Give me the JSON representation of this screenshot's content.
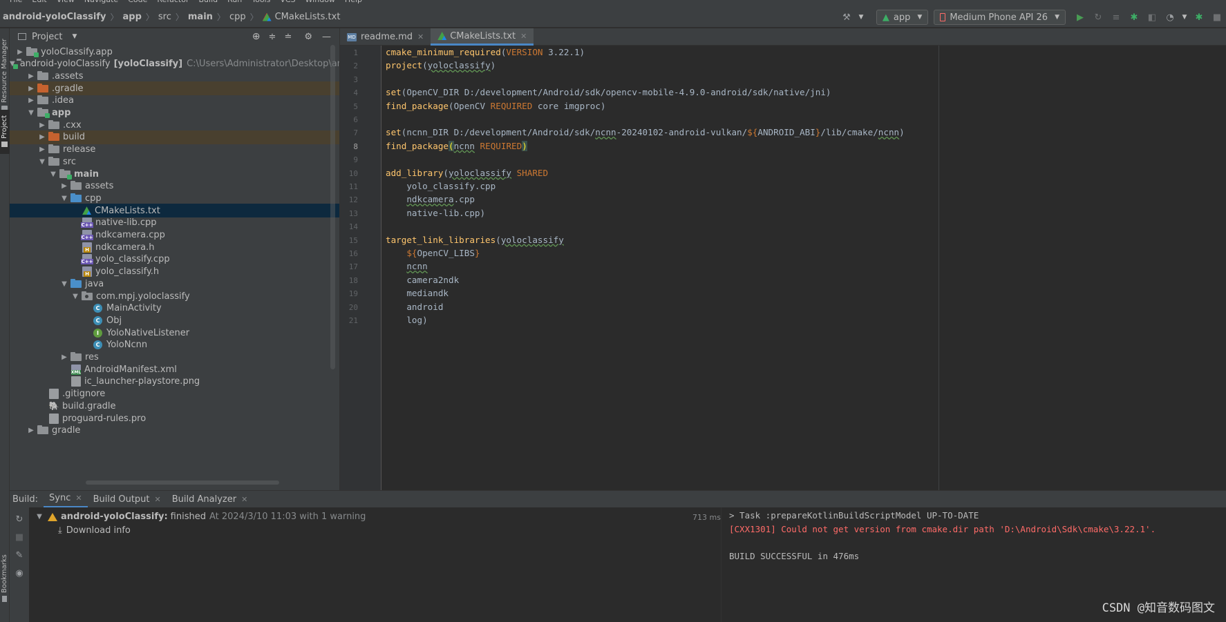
{
  "menu": [
    "File",
    "Edit",
    "View",
    "Navigate",
    "Code",
    "Refactor",
    "Build",
    "Run",
    "Tools",
    "VCS",
    "Window",
    "Help"
  ],
  "breadcrumb": [
    "android-yoloClassify",
    "app",
    "src",
    "main",
    "cpp",
    "CMakeLists.txt"
  ],
  "toolbar": {
    "config": "app",
    "device": "Medium Phone API 26"
  },
  "left_strip": {
    "resource_manager": "Resource Manager",
    "project": "Project",
    "bookmarks": "Bookmarks"
  },
  "project": {
    "header": "Project",
    "tree": [
      {
        "label": "yoloClassify.app",
        "extra": "",
        "icon": "folder-mod",
        "arrow": "right",
        "level": 0
      },
      {
        "label": "android-yoloClassify",
        "bold_suffix": "[yoloClassify]",
        "extra": "C:\\Users\\Administrator\\Desktop\\android",
        "icon": "folder-mod",
        "arrow": "down",
        "level": 0
      },
      {
        "label": ".assets",
        "icon": "folder-gray",
        "arrow": "right",
        "level": 1
      },
      {
        "label": ".gradle",
        "icon": "folder-orange",
        "arrow": "right",
        "level": 1,
        "excluded": true
      },
      {
        "label": ".idea",
        "icon": "folder-gray",
        "arrow": "right",
        "level": 1
      },
      {
        "label": "app",
        "icon": "folder-mod",
        "arrow": "down",
        "level": 1,
        "bold": true
      },
      {
        "label": ".cxx",
        "icon": "folder-gray",
        "arrow": "right",
        "level": 2
      },
      {
        "label": "build",
        "icon": "folder-orange",
        "arrow": "right",
        "level": 2,
        "excluded": true
      },
      {
        "label": "release",
        "icon": "folder-gray",
        "arrow": "right",
        "level": 2
      },
      {
        "label": "src",
        "icon": "folder-gray",
        "arrow": "down",
        "level": 2
      },
      {
        "label": "main",
        "icon": "folder-mod",
        "arrow": "down",
        "level": 3,
        "bold": true
      },
      {
        "label": "assets",
        "icon": "folder-gray",
        "arrow": "right",
        "level": 4
      },
      {
        "label": "cpp",
        "icon": "folder-blue",
        "arrow": "down",
        "level": 4
      },
      {
        "label": "CMakeLists.txt",
        "icon": "cmake",
        "arrow": "",
        "level": 5,
        "selected": true
      },
      {
        "label": "native-lib.cpp",
        "icon": "cpp",
        "arrow": "",
        "level": 5
      },
      {
        "label": "ndkcamera.cpp",
        "icon": "cpp",
        "arrow": "",
        "level": 5
      },
      {
        "label": "ndkcamera.h",
        "icon": "h",
        "arrow": "",
        "level": 5
      },
      {
        "label": "yolo_classify.cpp",
        "icon": "cpp",
        "arrow": "",
        "level": 5
      },
      {
        "label": "yolo_classify.h",
        "icon": "h",
        "arrow": "",
        "level": 5
      },
      {
        "label": "java",
        "icon": "folder-blue",
        "arrow": "down",
        "level": 4
      },
      {
        "label": "com.mpj.yoloclassify",
        "icon": "folder-pkg",
        "arrow": "down",
        "level": 5
      },
      {
        "label": "MainActivity",
        "icon": "class",
        "arrow": "",
        "level": 6
      },
      {
        "label": "Obj",
        "icon": "class",
        "arrow": "",
        "level": 6
      },
      {
        "label": "YoloNativeListener",
        "icon": "interface",
        "arrow": "",
        "level": 6
      },
      {
        "label": "YoloNcnn",
        "icon": "class",
        "arrow": "",
        "level": 6
      },
      {
        "label": "res",
        "icon": "folder-gray",
        "arrow": "right",
        "level": 4
      },
      {
        "label": "AndroidManifest.xml",
        "icon": "xml",
        "arrow": "",
        "level": 4
      },
      {
        "label": "ic_launcher-playstore.png",
        "icon": "txt",
        "arrow": "",
        "level": 4
      },
      {
        "label": ".gitignore",
        "icon": "txt",
        "arrow": "",
        "level": 2
      },
      {
        "label": "build.gradle",
        "icon": "gradle",
        "arrow": "",
        "level": 2
      },
      {
        "label": "proguard-rules.pro",
        "icon": "txt",
        "arrow": "",
        "level": 2
      },
      {
        "label": "gradle",
        "icon": "folder-gray",
        "arrow": "right",
        "level": 1
      }
    ]
  },
  "editor": {
    "tabs": [
      {
        "label": "readme.md",
        "active": false
      },
      {
        "label": "CMakeLists.txt",
        "active": true
      }
    ],
    "current_line": 8,
    "lines": [
      [
        [
          "fn",
          "cmake_minimum_required"
        ],
        [
          "p",
          "("
        ],
        [
          "kw",
          "VERSION"
        ],
        [
          "p",
          " 3.22.1)"
        ]
      ],
      [
        [
          "fn",
          "project"
        ],
        [
          "p",
          "("
        ],
        [
          "u",
          "yoloclassify"
        ],
        [
          "p",
          ")"
        ]
      ],
      [],
      [
        [
          "fn",
          "set"
        ],
        [
          "p",
          "(OpenCV_DIR D:/development/Android/sdk/opencv-mobile-4.9.0-android/sdk/native/jni)"
        ]
      ],
      [
        [
          "fn",
          "find_package"
        ],
        [
          "p",
          "(OpenCV "
        ],
        [
          "kw",
          "REQUIRED"
        ],
        [
          "p",
          " core imgproc)"
        ]
      ],
      [],
      [
        [
          "fn",
          "set"
        ],
        [
          "p",
          "(ncnn_DIR D:/development/Android/sdk/"
        ],
        [
          "u",
          "ncnn"
        ],
        [
          "p",
          "-20240102-android-vulkan/"
        ],
        [
          "kw",
          "${"
        ],
        [
          "p",
          "ANDROID_ABI"
        ],
        [
          "kw",
          "}"
        ],
        [
          "p",
          "/lib/cmake/"
        ],
        [
          "u",
          "ncnn"
        ],
        [
          "p",
          ")"
        ]
      ],
      [
        [
          "fn",
          "find_package"
        ],
        [
          "hl",
          "("
        ],
        [
          "u",
          "ncnn"
        ],
        [
          "p",
          " "
        ],
        [
          "kw",
          "REQUIRED"
        ],
        [
          "hl",
          ")"
        ]
      ],
      [],
      [
        [
          "fn",
          "add_library"
        ],
        [
          "p",
          "("
        ],
        [
          "u",
          "yoloclassify"
        ],
        [
          "p",
          " "
        ],
        [
          "kw",
          "SHARED"
        ]
      ],
      [
        [
          "p",
          "    yolo_classify.cpp"
        ]
      ],
      [
        [
          "p",
          "    "
        ],
        [
          "u",
          "ndkcamera"
        ],
        [
          "p",
          ".cpp"
        ]
      ],
      [
        [
          "p",
          "    native-lib.cpp)"
        ]
      ],
      [],
      [
        [
          "fn",
          "target_link_libraries"
        ],
        [
          "p",
          "("
        ],
        [
          "u",
          "yoloclassify"
        ]
      ],
      [
        [
          "p",
          "    "
        ],
        [
          "kw",
          "${"
        ],
        [
          "p",
          "OpenCV_LIBS"
        ],
        [
          "kw",
          "}"
        ]
      ],
      [
        [
          "p",
          "    "
        ],
        [
          "u",
          "ncnn"
        ]
      ],
      [
        [
          "p",
          "    camera2ndk"
        ]
      ],
      [
        [
          "p",
          "    mediandk"
        ]
      ],
      [
        [
          "p",
          "    android"
        ]
      ],
      [
        [
          "p",
          "    log)"
        ]
      ]
    ]
  },
  "build": {
    "label": "Build:",
    "tabs": [
      {
        "label": "Sync",
        "active": true
      },
      {
        "label": "Build Output",
        "active": false
      },
      {
        "label": "Build Analyzer",
        "active": false
      }
    ],
    "tree": {
      "project": "android-yoloClassify:",
      "status": "finished",
      "time": "At 2024/3/10 11:03 with 1 warning",
      "duration": "713 ms",
      "child": "Download info"
    },
    "console": [
      {
        "text": "> Task :prepareKotlinBuildScriptModel UP-TO-DATE",
        "color": "#bbbbbb"
      },
      {
        "text": "[CXX1301] Could not get version from cmake.dir path 'D:\\Android\\Sdk\\cmake\\3.22.1'.",
        "color": "#ff6b68"
      },
      {
        "text": "",
        "color": "#bbbbbb"
      },
      {
        "text": "BUILD SUCCESSFUL in 476ms",
        "color": "#bbbbbb"
      }
    ]
  },
  "watermark": "CSDN @知音数码图文",
  "colors": {
    "function": "#ffc66d",
    "keyword": "#cc7832",
    "plain": "#a9b7c6",
    "bracket_highlight": "#ffef28",
    "error": "#ff6b68",
    "accent": "#4a88c7"
  }
}
